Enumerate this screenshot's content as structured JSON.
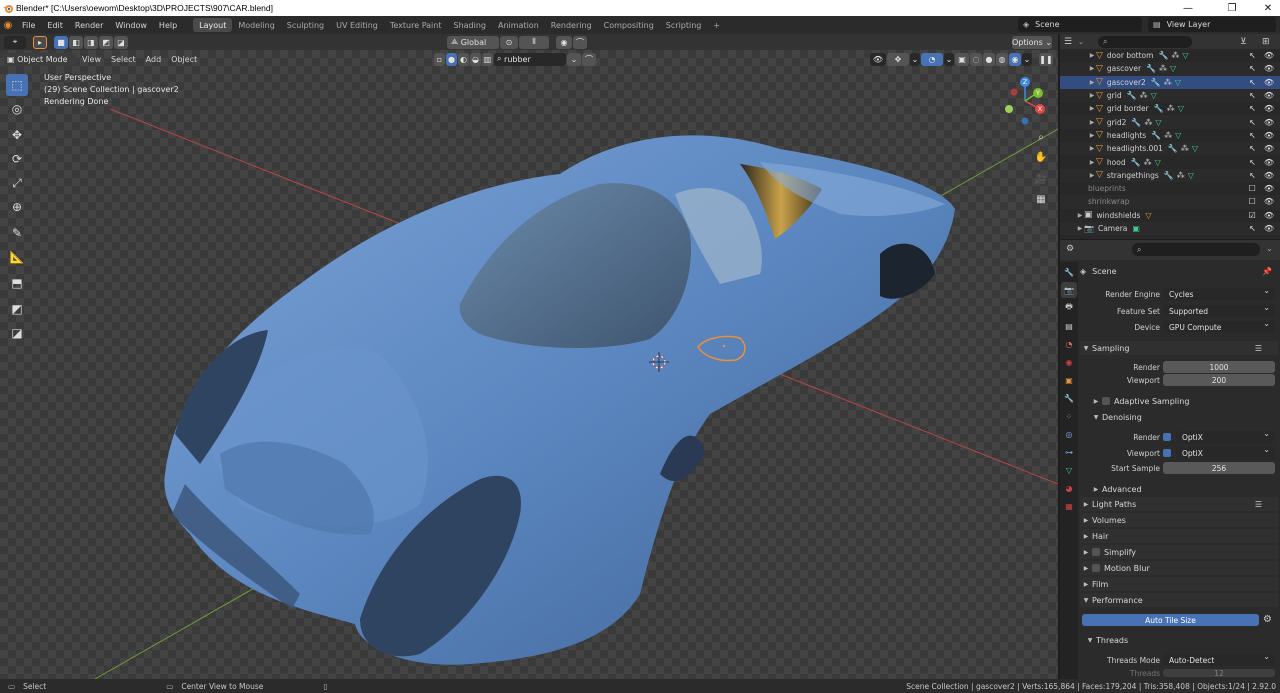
{
  "window": {
    "title": "Blender* [C:\\Users\\oewom\\Desktop\\3D\\PROJECTS\\907\\CAR.blend]",
    "min_icon": "minimize-icon",
    "max_icon": "maximize-icon",
    "close_icon": "close-icon"
  },
  "menu": {
    "items": [
      "File",
      "Edit",
      "Render",
      "Window",
      "Help"
    ],
    "workspaces": [
      "Layout",
      "Modeling",
      "Sculpting",
      "UV Editing",
      "Texture Paint",
      "Shading",
      "Animation",
      "Rendering",
      "Compositing",
      "Scripting"
    ],
    "active_workspace": "Layout",
    "add_tab": "+",
    "scene": "Scene",
    "view_layer": "View Layer"
  },
  "viewport": {
    "transform_orientation": "Global",
    "options_label": "Options",
    "mode": "Object Mode",
    "menus": [
      "View",
      "Select",
      "Add",
      "Object"
    ],
    "material_search": "rubber",
    "overlay_lines": [
      "User Perspective",
      "(29) Scene Collection | gascover2",
      "Rendering Done"
    ],
    "gizmo_axes": {
      "x": "X",
      "y": "Y",
      "z": "Z"
    }
  },
  "outliner": {
    "rows": [
      {
        "label": "door bottom",
        "type": "mesh"
      },
      {
        "label": "gascover",
        "type": "mesh"
      },
      {
        "label": "gascover2",
        "type": "mesh",
        "selected": true
      },
      {
        "label": "grid",
        "type": "mesh"
      },
      {
        "label": "grid border",
        "type": "mesh"
      },
      {
        "label": "grid2",
        "type": "mesh"
      },
      {
        "label": "headlights",
        "type": "mesh"
      },
      {
        "label": "headlights.001",
        "type": "mesh"
      },
      {
        "label": "hood",
        "type": "mesh"
      },
      {
        "label": "strangethings",
        "type": "mesh"
      },
      {
        "label": "blueprints",
        "type": "collection",
        "dim": true
      },
      {
        "label": "shrinkwrap",
        "type": "collection",
        "dim": true
      },
      {
        "label": "windshields",
        "type": "collection"
      },
      {
        "label": "Camera",
        "type": "camera"
      }
    ]
  },
  "properties": {
    "context": "Scene",
    "render_engine_label": "Render Engine",
    "render_engine": "Cycles",
    "feature_set_label": "Feature Set",
    "feature_set": "Supported",
    "device_label": "Device",
    "device": "GPU Compute",
    "sampling_label": "Sampling",
    "render_label": "Render",
    "render_samples": "1000",
    "viewport_label": "Viewport",
    "viewport_samples": "200",
    "adaptive_sampling": "Adaptive Sampling",
    "denoising": "Denoising",
    "denoise_render_label": "Render",
    "denoise_render": "OptiX",
    "denoise_viewport_label": "Viewport",
    "denoise_viewport": "OptiX",
    "start_sample_label": "Start Sample",
    "start_sample": "256",
    "advanced": "Advanced",
    "light_paths": "Light Paths",
    "volumes": "Volumes",
    "hair": "Hair",
    "simplify": "Simplify",
    "motion_blur": "Motion Blur",
    "film": "Film",
    "performance": "Performance",
    "auto_tile": "Auto Tile Size",
    "threads": "Threads",
    "threads_mode_label": "Threads Mode",
    "threads_mode": "Auto-Detect",
    "threads_count_label": "Threads",
    "threads_count": "12"
  },
  "status": {
    "select": "Select",
    "center": "Center View to Mouse",
    "stats": "Scene Collection | gascover2 | Verts:165,864 | Faces:179,204 | Tris:358,408 | Objects:1/24 | 2.92.0"
  },
  "colors": {
    "accent": "#4772b3",
    "car_body": "#5b86bf",
    "selection": "#e8913a"
  }
}
